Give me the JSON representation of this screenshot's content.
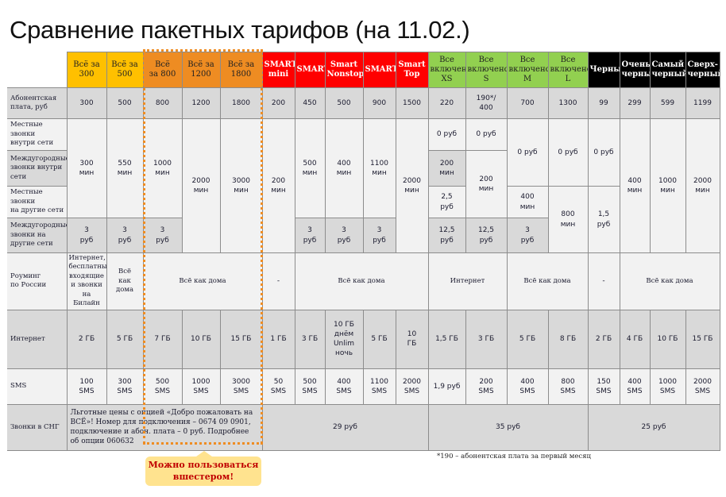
{
  "title": "Сравнение пакетных тарифов (на 11.02.)",
  "colors": {
    "yellow": "#ffc000",
    "orange": "#ee8c22",
    "red": "#ff0000",
    "green": "#92d050",
    "black": "#000000",
    "callout_text": "#c00000"
  },
  "header": [
    "Всё за\n300",
    "Всё за\n500",
    "Всё\nза 800",
    "Всё за\n1200",
    "Всё за\n1800",
    "SMART\nmini",
    "SMART",
    "Smart\nNonstop",
    "SMART+",
    "Smart\nTop",
    "Все\nвключено\nXS",
    "Все\nвключено\nS",
    "Все\nвключено\nM",
    "Все\nвключено\nL",
    "Черный",
    "Очень\nчерный",
    "Самый\nчерный",
    "Сверх-\nчерный"
  ],
  "rows": [
    {
      "label": "Абонентская\nплата, руб",
      "cells": [
        "300",
        "500",
        "800",
        "1200",
        "1800",
        "200",
        "450",
        "500",
        "900",
        "1500",
        "220",
        "190*/\n400",
        "700",
        "1300",
        "99",
        "299",
        "599",
        "1199"
      ]
    },
    {
      "label": "Местные звонки\nвнутри сети",
      "cells": [
        "300\nмин",
        "550\nмин",
        "1000\nмин",
        "2000\nмин",
        "3000\nмин",
        "200\nмин",
        "500\nмин",
        "400\nмин",
        "1100\nмин",
        "2000\nмин",
        "0 руб",
        "0 руб",
        "0 руб",
        "0 руб",
        "0 руб",
        "400\nмин",
        "1000\nмин",
        "2000\nмин"
      ]
    },
    {
      "label": "Междугородные\nзвонки внутри\nсети",
      "cells": [
        "200\nмин",
        "200\nмин"
      ]
    },
    {
      "label": "Местные звонки\nна другие сети",
      "cells": [
        "2,5\nруб",
        "400\nмин",
        "800\nмин",
        "1,5\nруб"
      ]
    },
    {
      "label": "Междугородные\nзвонки на\nдругие сети",
      "cells": [
        "3\nруб",
        "3\nруб",
        "3\nруб",
        "3\nруб",
        "3\nруб",
        "3\nруб",
        "12,5\nруб",
        "12,5\nруб",
        "3\nруб"
      ]
    },
    {
      "label": "Роуминг\nпо России",
      "cells": [
        "Интернет,\nбесплатные\nвходящие\nи звонки\nна Билайн",
        "Всё\nкак\nдома",
        "Всё как дома",
        "-",
        "Всё как дома",
        "Интернет",
        "Всё как дома",
        "-",
        "Всё как дома"
      ]
    },
    {
      "label": "Интернет",
      "cells": [
        "2 ГБ",
        "5 ГБ",
        "7 ГБ",
        "10 ГБ",
        "15 ГБ",
        "1 ГБ",
        "3 ГБ",
        "10 ГБ\nднём\nUnlim\nночь",
        "5 ГБ",
        "10\nГБ",
        "1,5 ГБ",
        "3 ГБ",
        "5 ГБ",
        "8 ГБ",
        "2 ГБ",
        "4 ГБ",
        "10 ГБ",
        "15 ГБ"
      ]
    },
    {
      "label": "SMS",
      "cells": [
        "100\nSMS",
        "300\nSMS",
        "500\nSMS",
        "1000\nSMS",
        "3000\nSMS",
        "50\nSMS",
        "500\nSMS",
        "400\nSMS",
        "1100\nSMS",
        "2000\nSMS",
        "1,9 руб",
        "200\nSMS",
        "400\nSMS",
        "800\nSMS",
        "150\nSMS",
        "400\nSMS",
        "1000\nSMS",
        "2000\nSMS"
      ]
    },
    {
      "label": "Звонки в СНГ",
      "cells": [
        "Льготные цены с опцией «Добро пожаловать на ВСЁ»! Номер для подключения – 0674 09 0901, подключение и абон. плата – 0 руб. Подробнее об опции 060632",
        "29 руб",
        "35 руб",
        "25 руб"
      ]
    }
  ],
  "callout": "Можно пользоваться\nвшестером!",
  "footnote": "*190 – абонентская плата за первый месяц"
}
